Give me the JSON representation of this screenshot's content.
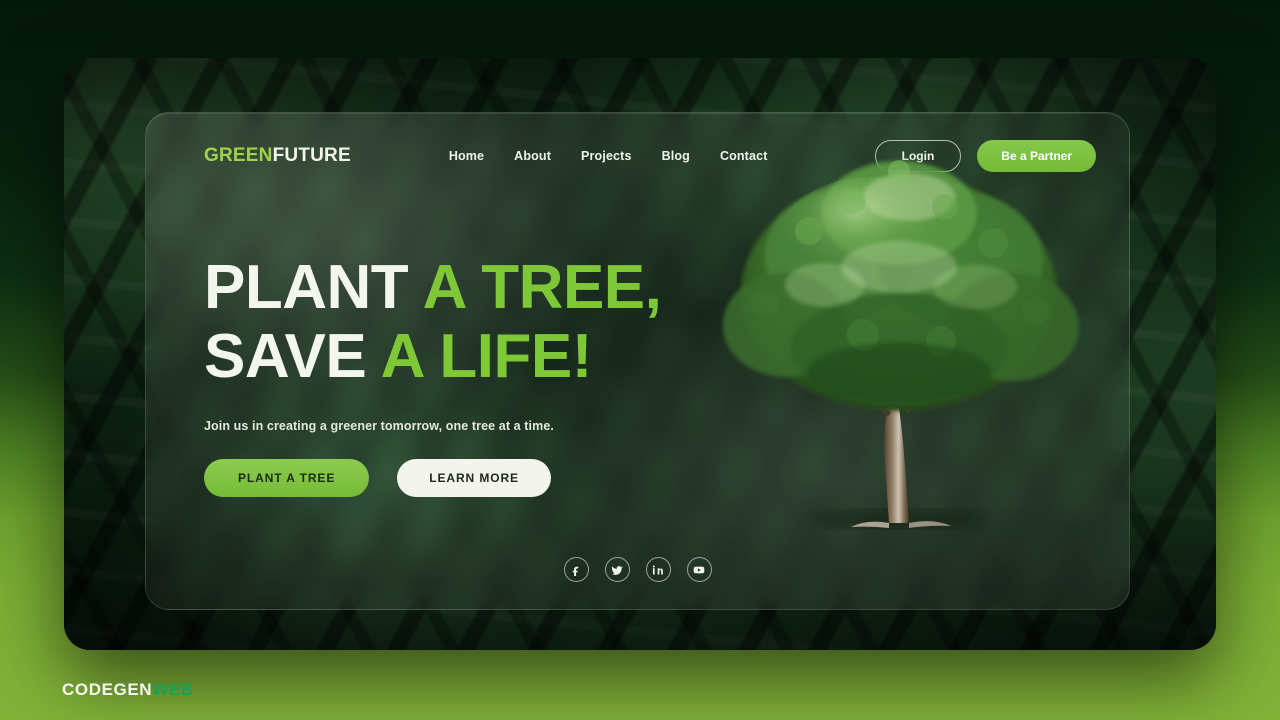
{
  "brand": {
    "logo_primary": "GREEN",
    "logo_secondary": "FUTURE"
  },
  "nav": {
    "links": [
      {
        "label": "Home"
      },
      {
        "label": "About"
      },
      {
        "label": "Projects"
      },
      {
        "label": "Blog"
      },
      {
        "label": "Contact"
      }
    ],
    "login_label": "Login",
    "partner_label": "Be a Partner"
  },
  "hero": {
    "headline_line1_white": "PLANT",
    "headline_line1_green": "A TREE,",
    "headline_line2_white": "SAVE",
    "headline_line2_green": "A LIFE!",
    "subtitle": "Join us in creating a greener tomorrow, one tree at a time.",
    "cta_primary": "PLANT A TREE",
    "cta_secondary": "LEARN MORE",
    "image_alt": "broadleaf-tree-illustration"
  },
  "social": [
    {
      "name": "facebook-icon"
    },
    {
      "name": "twitter-icon"
    },
    {
      "name": "linkedin-icon"
    },
    {
      "name": "youtube-icon"
    }
  ],
  "watermark": {
    "primary": "CODEGEN",
    "secondary": "WEB"
  },
  "colors": {
    "accent_green": "#7ac13f",
    "headline_green": "#7ec837",
    "logo_green": "#9fd44a",
    "cream": "#f3f5ec",
    "watermark_green": "#15a15a",
    "page_top": "#04170b",
    "page_bottom": "#82b238"
  }
}
